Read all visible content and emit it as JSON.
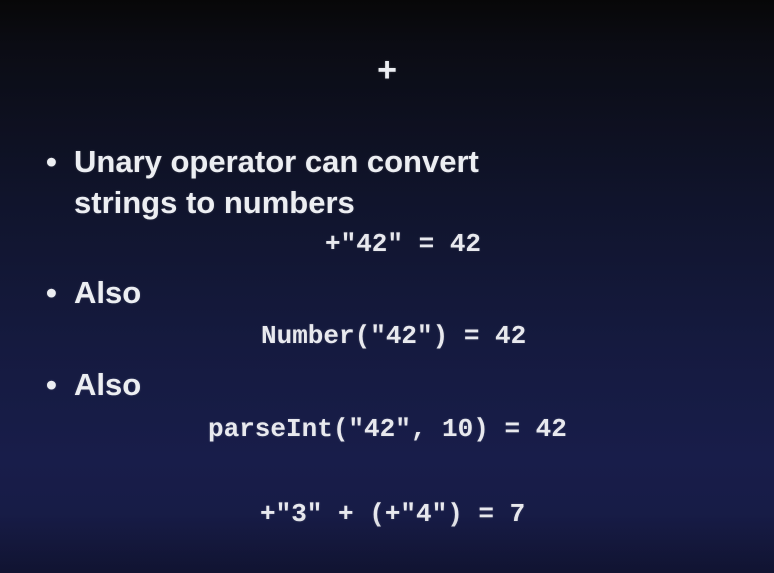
{
  "slide": {
    "title": "+",
    "bullets": [
      {
        "marker": "•",
        "line1": "Unary operator can convert",
        "line2": "strings to numbers"
      },
      {
        "marker": "•",
        "line1": "Also"
      },
      {
        "marker": "•",
        "line1": "Also"
      }
    ],
    "code": [
      "+\"42\" = 42",
      "Number(\"42\") = 42",
      "parseInt(\"42\", 10) = 42",
      "+\"3\" + (+\"4\") = 7"
    ]
  }
}
